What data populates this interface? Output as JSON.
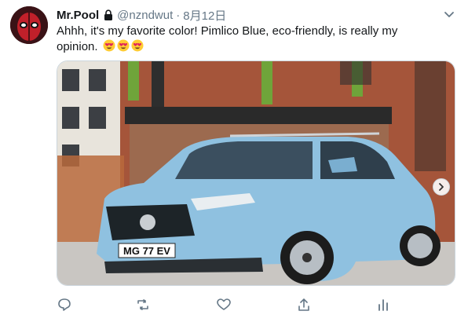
{
  "tweet": {
    "display_name": "Mr.Pool",
    "handle": "@nzndwut",
    "separator": "·",
    "date": "8月12日",
    "text": "Ahhh, it's my favorite color! Pimlico Blue, eco-friendly, is really my opinion.",
    "emojis": [
      "heart-eyes-emoji",
      "heart-eyes-emoji",
      "heart-eyes-emoji"
    ],
    "media": {
      "plate_text": "MG 77 EV",
      "car_color": "#8fc1e0"
    }
  },
  "icons": {
    "lock": "lock-icon",
    "caret": "chevron-down-icon",
    "reply": "reply-icon",
    "retweet": "retweet-icon",
    "like": "heart-icon",
    "share": "share-icon",
    "analytics": "analytics-icon",
    "carousel_next": "chevron-right-icon"
  },
  "colors": {
    "text": "#14171a",
    "secondary": "#657786",
    "border": "#ccd6dd"
  }
}
